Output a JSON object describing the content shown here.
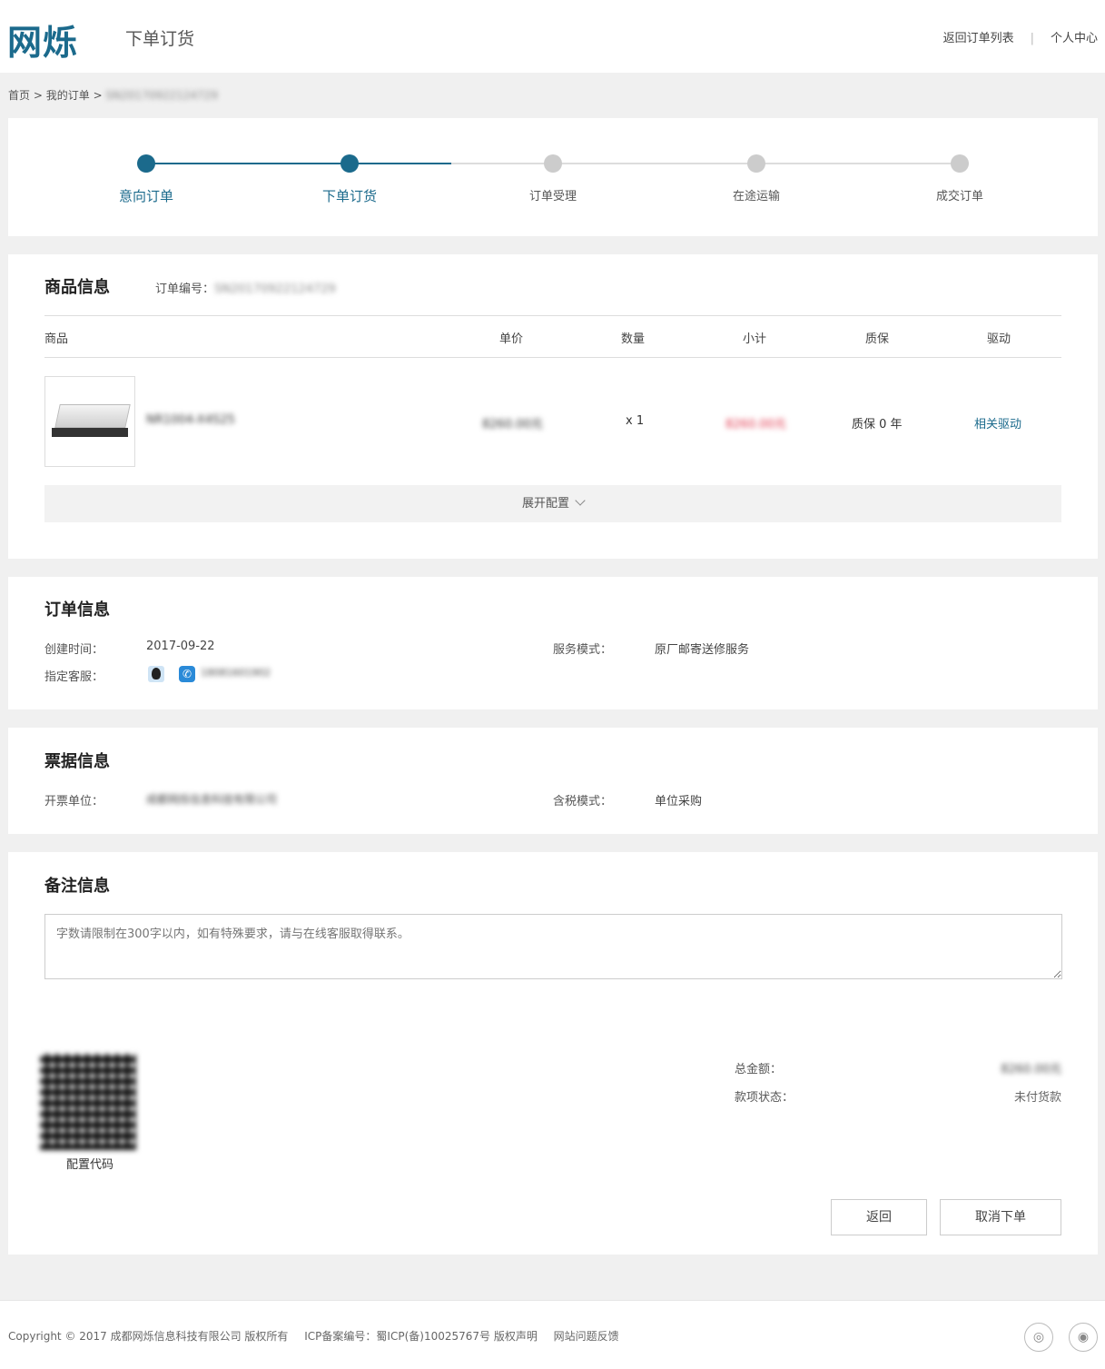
{
  "header": {
    "logo": "网烁",
    "title": "下单订货",
    "nav": [
      "返回订单列表",
      "个人中心"
    ],
    "nav_sep": "|"
  },
  "breadcrumb": {
    "home": "首页",
    "orders": "我的订单",
    "sep": ">",
    "current": "SN20170922124729"
  },
  "steps": [
    {
      "label": "意向订单",
      "active": true
    },
    {
      "label": "下单订货",
      "active": true
    },
    {
      "label": "订单受理",
      "active": false
    },
    {
      "label": "在途运输",
      "active": false
    },
    {
      "label": "成交订单",
      "active": false
    }
  ],
  "goods": {
    "title": "商品信息",
    "order_no_label": "订单编号：",
    "order_no": "SN20170922124729",
    "columns": [
      "商品",
      "单价",
      "数量",
      "小计",
      "质保",
      "驱动"
    ],
    "item": {
      "name": "NR1004-X4S25",
      "price": "8260.00元",
      "qty": "x 1",
      "subtotal": "8260.00元",
      "warranty": "质保 0 年",
      "driver": "相关驱动"
    },
    "expand_label": "展开配置"
  },
  "order_info": {
    "title": "订单信息",
    "created_label": "创建时间：",
    "created": "2017-09-22",
    "service_label": "服务模式：",
    "service": "原厂邮寄送修服务",
    "cs_label": "指定客服：",
    "cs_phone": "18081601902"
  },
  "invoice": {
    "title": "票据信息",
    "unit_label": "开票单位：",
    "unit": "成都网烁信息科技有限公司",
    "tax_label": "含税模式：",
    "tax": "单位采购"
  },
  "remark": {
    "title": "备注信息",
    "placeholder": "字数请限制在300字以内，如有特殊要求，请与在线客服取得联系。",
    "qr_caption": "配置代码",
    "total_label": "总金额：",
    "total": "8260.00元",
    "pay_status_label": "款项状态：",
    "pay_status": "未付货款",
    "back_btn": "返回",
    "cancel_btn": "取消下单"
  },
  "footer": {
    "copyright": "Copyright © 2017 成都网烁信息科技有限公司 版权所有",
    "icp": "ICP备案编号：蜀ICP(备)10025767号 版权声明",
    "feedback": "网站问题反馈",
    "icons": [
      "wechat-icon",
      "weibo-icon"
    ]
  },
  "colors": {
    "accent": "#1b6a8c",
    "price_red": "#e0344a"
  }
}
